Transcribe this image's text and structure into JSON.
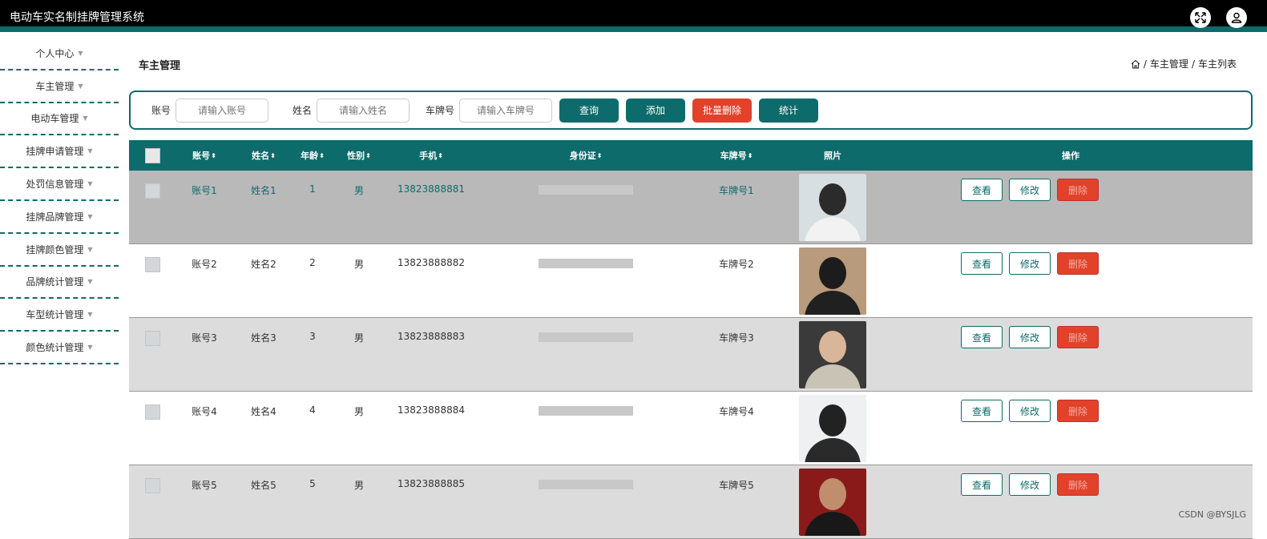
{
  "app": {
    "title": "电动车实名制挂牌管理系统"
  },
  "topbar": {
    "fullscreen_icon": "expand-arrows-icon",
    "user_icon": "user-icon"
  },
  "sidebar": {
    "items": [
      {
        "label": "个人中心"
      },
      {
        "label": "车主管理"
      },
      {
        "label": "电动车管理"
      },
      {
        "label": "挂牌申请管理"
      },
      {
        "label": "处罚信息管理"
      },
      {
        "label": "挂牌品牌管理"
      },
      {
        "label": "挂牌颜色管理"
      },
      {
        "label": "品牌统计管理"
      },
      {
        "label": "车型统计管理"
      },
      {
        "label": "颜色统计管理"
      }
    ]
  },
  "page": {
    "title": "车主管理",
    "breadcrumb": {
      "sep": "/",
      "level1": "车主管理",
      "level2": "车主列表"
    }
  },
  "search": {
    "account_label": "账号",
    "account_placeholder": "请输入账号",
    "name_label": "姓名",
    "name_placeholder": "请输入姓名",
    "plate_label": "车牌号",
    "plate_placeholder": "请输入车牌号",
    "query_label": "查询",
    "add_label": "添加",
    "batch_delete_label": "批量删除",
    "stats_label": "统计"
  },
  "table": {
    "headers": {
      "account": "账号",
      "name": "姓名",
      "age": "年龄",
      "sex": "性别",
      "phone": "手机",
      "id": "身份证",
      "plate": "车牌号",
      "photo": "照片",
      "ops": "操作"
    },
    "sort_glyph": "⬍",
    "ops": {
      "view": "查看",
      "edit": "修改",
      "delete": "删除"
    },
    "rows": [
      {
        "account": "账号1",
        "name": "姓名1",
        "age": "1",
        "sex": "男",
        "phone": "13823888881",
        "plate": "车牌号1"
      },
      {
        "account": "账号2",
        "name": "姓名2",
        "age": "2",
        "sex": "男",
        "phone": "13823888882",
        "plate": "车牌号2"
      },
      {
        "account": "账号3",
        "name": "姓名3",
        "age": "3",
        "sex": "男",
        "phone": "13823888883",
        "plate": "车牌号3"
      },
      {
        "account": "账号4",
        "name": "姓名4",
        "age": "4",
        "sex": "男",
        "phone": "13823888884",
        "plate": "车牌号4"
      },
      {
        "account": "账号5",
        "name": "姓名5",
        "age": "5",
        "sex": "男",
        "phone": "13823888885",
        "plate": "车牌号5"
      }
    ]
  },
  "watermark": "CSDN @BYSJLG",
  "colors": {
    "accent": "#0e6b6b",
    "danger": "#e2412a",
    "topbar": "#000000"
  }
}
